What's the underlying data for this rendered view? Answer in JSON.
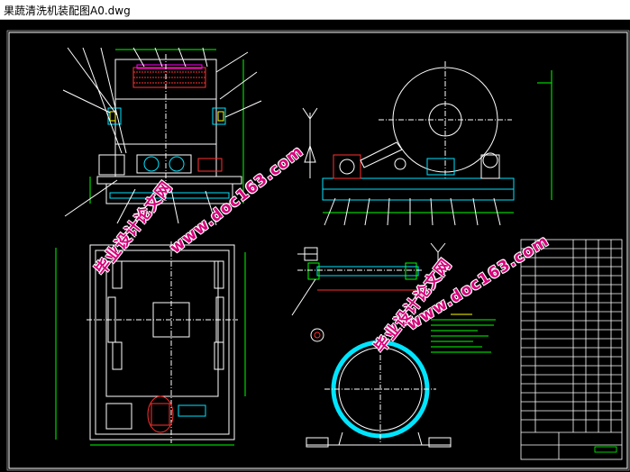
{
  "window": {
    "title": "果蔬清洗机装配图A0.dwg"
  },
  "watermarks": [
    {
      "text": "毕业设计论文网"
    },
    {
      "text": "www.doc163.com"
    },
    {
      "text": "毕业设计论文网"
    },
    {
      "text": "www.doc163.com"
    }
  ],
  "colors": {
    "background": "#000000",
    "line_white": "#ffffff",
    "line_green": "#00ff00",
    "line_cyan": "#00e5ff",
    "line_red": "#ff3030",
    "line_yellow": "#ffff00",
    "line_magenta": "#ff00ff",
    "watermark": "#d6007a"
  }
}
